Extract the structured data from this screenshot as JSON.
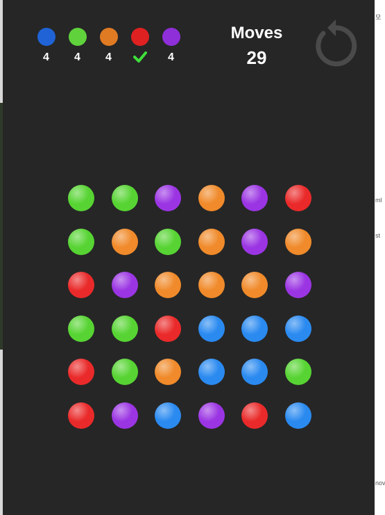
{
  "legend": [
    {
      "color": "#1f63d6",
      "count": "4",
      "done": false
    },
    {
      "color": "#5fd23c",
      "count": "4",
      "done": false
    },
    {
      "color": "#e07b24",
      "count": "4",
      "done": false
    },
    {
      "color": "#e02121",
      "count": "",
      "done": true
    },
    {
      "color": "#8f2fd9",
      "count": "4",
      "done": false
    }
  ],
  "moves": {
    "label": "Moves",
    "value": "29"
  },
  "colors": {
    "green": "#57d433",
    "purple": "#9b35e3",
    "orange": "#f08a2a",
    "red": "#ea2a2a",
    "blue": "#2a8af0"
  },
  "board": [
    [
      "green",
      "green",
      "purple",
      "orange",
      "purple",
      "red"
    ],
    [
      "green",
      "orange",
      "green",
      "orange",
      "purple",
      "orange"
    ],
    [
      "red",
      "purple",
      "orange",
      "orange",
      "orange",
      "purple"
    ],
    [
      "green",
      "green",
      "red",
      "blue",
      "blue",
      "blue"
    ],
    [
      "red",
      "green",
      "orange",
      "blue",
      "blue",
      "green"
    ],
    [
      "red",
      "purple",
      "blue",
      "purple",
      "red",
      "blue"
    ]
  ],
  "edge_labels": [
    "모",
    "ml",
    "st",
    "nov"
  ]
}
